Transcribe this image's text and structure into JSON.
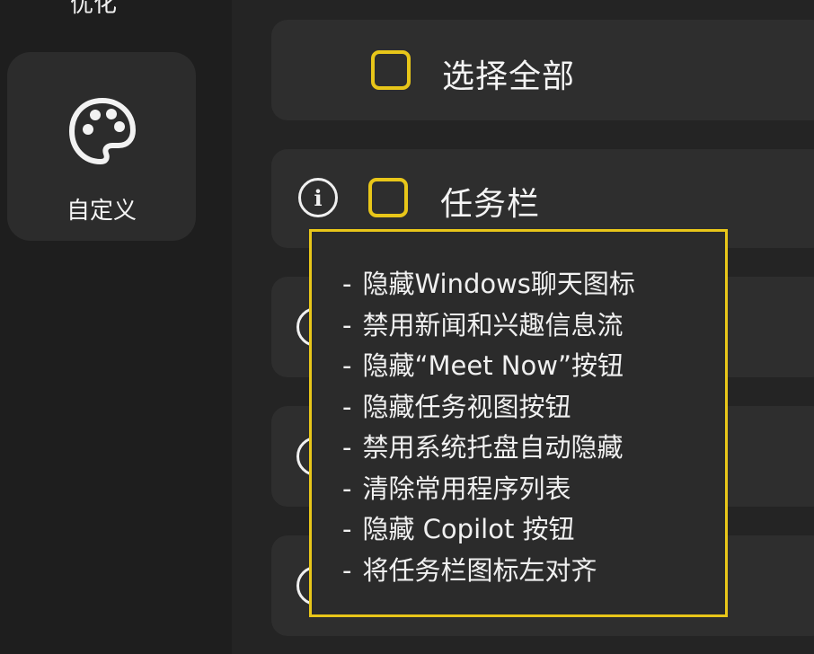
{
  "sidebar": {
    "top_label": "优化",
    "active_item": {
      "label": "自定义",
      "icon": "palette-icon"
    }
  },
  "main": {
    "select_all": {
      "label": "选择全部",
      "checked": false
    },
    "taskbar": {
      "label": "任务栏",
      "checked": false,
      "info_icon": "info-icon"
    }
  },
  "tooltip": {
    "items": [
      "隐藏Windows聊天图标",
      "禁用新闻和兴趣信息流",
      "隐藏“Meet Now”按钮",
      "隐藏任务视图按钮",
      "禁用系统托盘自动隐藏",
      "清除常用程序列表",
      "隐藏 Copilot 按钮",
      "将任务栏图标左对齐"
    ],
    "bullet": "-"
  },
  "colors": {
    "accent": "#e8c619",
    "background": "#242424",
    "card": "#2e2e2e",
    "text": "#f2f2f2"
  }
}
